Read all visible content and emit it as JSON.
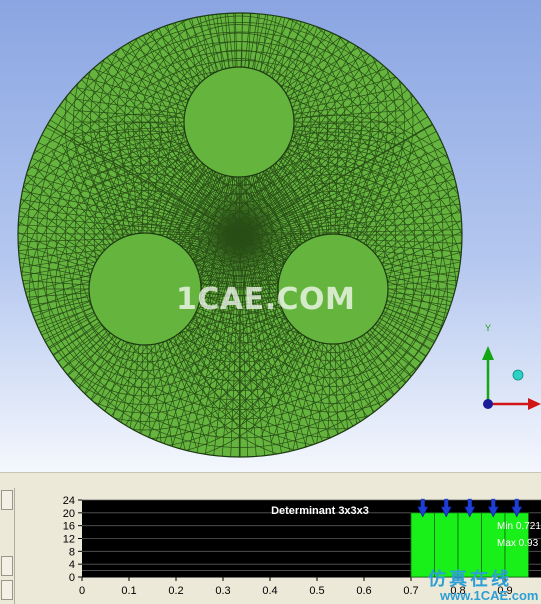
{
  "viewport": {
    "watermark": "1CAE.COM",
    "axis_y_label": "Y",
    "mesh_color": "#64b43e",
    "mesh_line_color": "#1f3d10"
  },
  "histogram": {
    "title": "Determinant 3x3x3",
    "min_label": "Min 0.721",
    "max_label": "Max 0.93",
    "bar_color": "#19ef19",
    "corner_watermark": "仿真在线",
    "corner_watermark_sub": "www.1CAE.com",
    "chart_data": {
      "type": "bar",
      "title": "Determinant 3x3x3",
      "x_ticks": [
        "0",
        "0.1",
        "0.2",
        "0.3",
        "0.4",
        "0.5",
        "0.6",
        "0.7",
        "0.8",
        "0.9",
        "1"
      ],
      "y_ticks": [
        "0",
        "2",
        "4",
        "8",
        "12",
        "16",
        "20",
        "24"
      ],
      "xlim": [
        0,
        1
      ],
      "ylim": [
        0,
        24
      ],
      "bins": [
        {
          "x0": 0.7,
          "x1": 0.75,
          "value": 20
        },
        {
          "x0": 0.75,
          "x1": 0.8,
          "value": 20
        },
        {
          "x0": 0.8,
          "x1": 0.85,
          "value": 20
        },
        {
          "x0": 0.85,
          "x1": 0.9,
          "value": 20
        },
        {
          "x0": 0.9,
          "x1": 0.95,
          "value": 20
        }
      ]
    }
  }
}
